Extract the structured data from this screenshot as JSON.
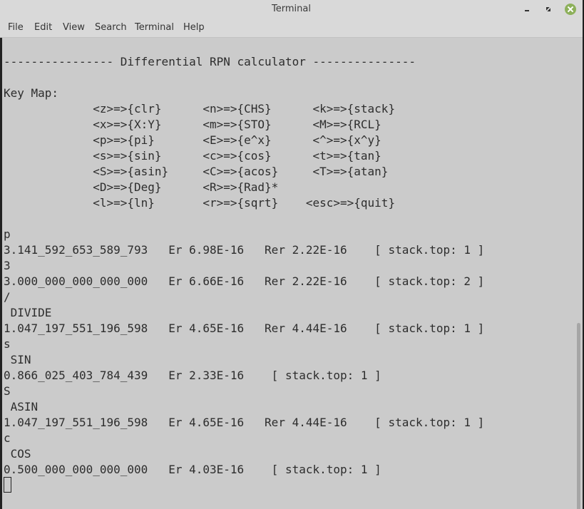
{
  "window": {
    "title": "Terminal",
    "controls": {
      "minimize": "minimize",
      "maximize": "maximize",
      "close": "close"
    },
    "close_color": "#8db05a"
  },
  "menu": [
    "File",
    "Edit",
    "View",
    "Search",
    "Terminal",
    "Help"
  ],
  "terminal": {
    "header": "---------------- Differential RPN calculator ---------------",
    "keymap_title": "Key Map:",
    "keymap_rows": [
      "             <z>=>{clr}      <n>=>{CHS}      <k>=>{stack}",
      "             <x>=>{X:Y}      <m>=>{STO}      <M>=>{RCL}",
      "             <p>=>{pi}       <E>=>{e^x}      <^>=>{x^y}",
      "             <s>=>{sin}      <c>=>{cos}      <t>=>{tan}",
      "             <S>=>{asin}     <C>=>{acos}     <T>=>{atan}",
      "             <D>=>{Deg}      <R>=>{Rad}*",
      "             <l>=>{ln}       <r>=>{sqrt}    <esc>=>{quit}"
    ],
    "output": [
      "p",
      "3.141_592_653_589_793   Er 6.98E-16   Rer 2.22E-16    [ stack.top: 1 ]",
      "3",
      "3.000_000_000_000_000   Er 6.66E-16   Rer 2.22E-16    [ stack.top: 2 ]",
      "/",
      " DIVIDE",
      "1.047_197_551_196_598   Er 4.65E-16   Rer 4.44E-16    [ stack.top: 1 ]",
      "s",
      " SIN",
      "0.866_025_403_784_439   Er 2.33E-16    [ stack.top: 1 ]",
      "S",
      " ASIN",
      "1.047_197_551_196_598   Er 4.65E-16   Rer 4.44E-16    [ stack.top: 1 ]",
      "c",
      " COS",
      "0.500_000_000_000_000   Er 4.03E-16    [ stack.top: 1 ]"
    ]
  }
}
